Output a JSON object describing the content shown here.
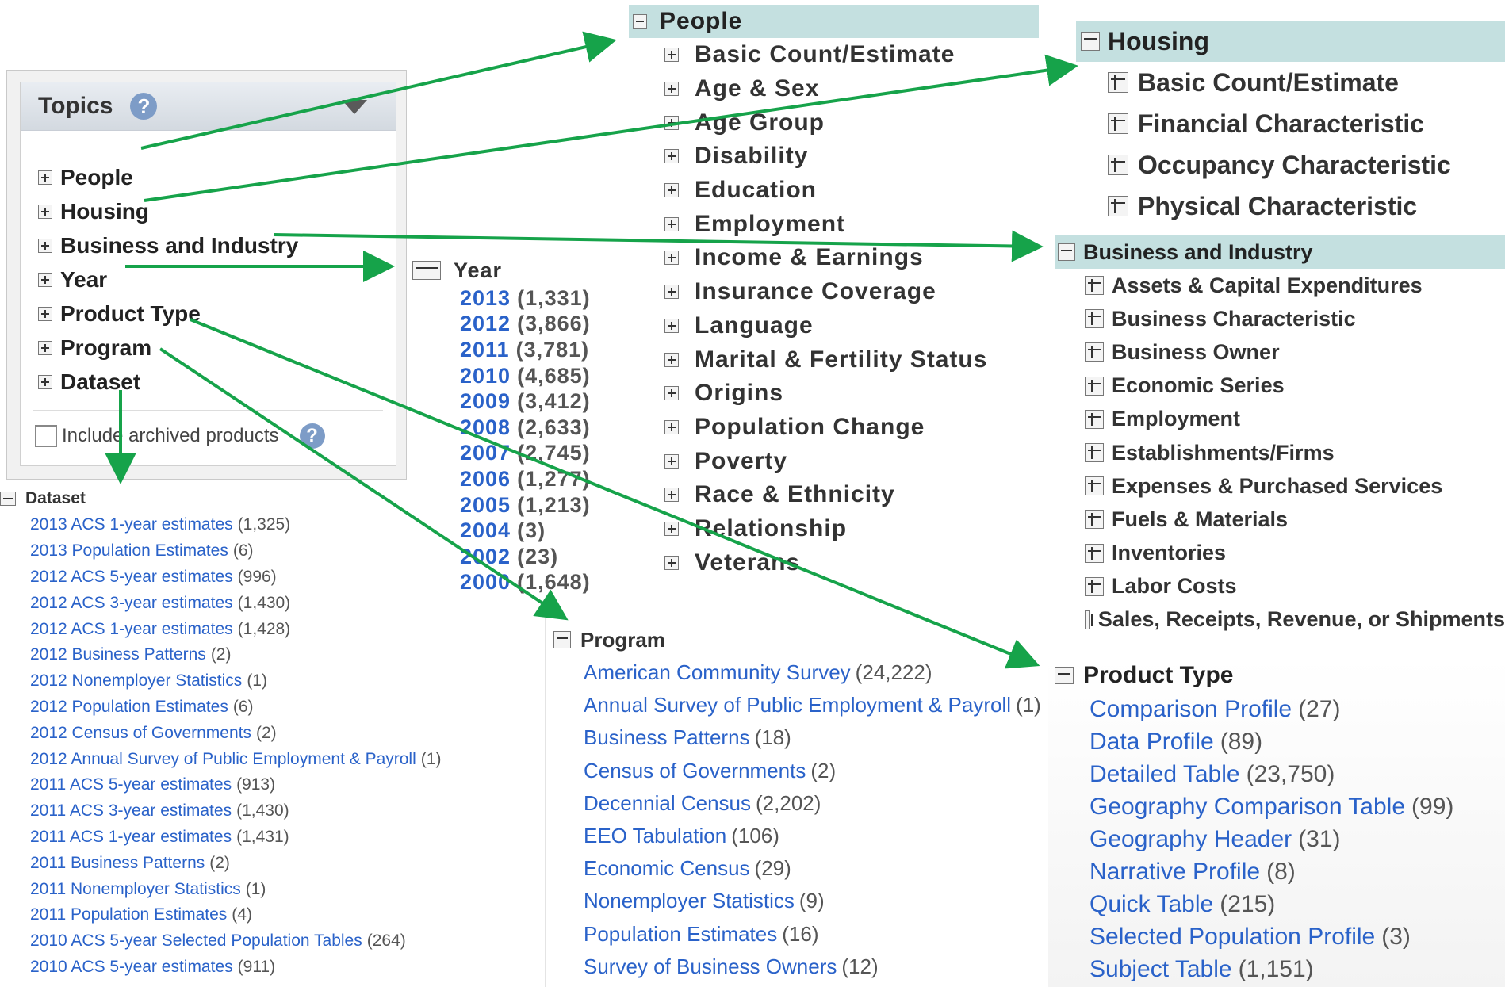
{
  "topics": {
    "title": "Topics",
    "help_icon": "question-icon",
    "collapse_icon": "triangle-down-icon",
    "items": [
      "People",
      "Housing",
      "Business and Industry",
      "Year",
      "Product Type",
      "Program",
      "Dataset"
    ],
    "archived_label": "Include archived products"
  },
  "people": {
    "title": "People",
    "items": [
      "Basic Count/Estimate",
      "Age & Sex",
      "Age Group",
      "Disability",
      "Education",
      "Employment",
      "Income & Earnings",
      "Insurance Coverage",
      "Language",
      "Marital & Fertility Status",
      "Origins",
      "Population Change",
      "Poverty",
      "Race & Ethnicity",
      "Relationship",
      "Veterans"
    ]
  },
  "housing": {
    "title": "Housing",
    "items": [
      "Basic Count/Estimate",
      "Financial Characteristic",
      "Occupancy Characteristic",
      "Physical Characteristic"
    ]
  },
  "business": {
    "title": "Business and Industry",
    "items": [
      "Assets & Capital Expenditures",
      "Business Characteristic",
      "Business Owner",
      "Economic Series",
      "Employment",
      "Establishments/Firms",
      "Expenses & Purchased Services",
      "Fuels & Materials",
      "Inventories",
      "Labor Costs",
      "Sales, Receipts, Revenue, or Shipments"
    ]
  },
  "year": {
    "title": "Year",
    "items": [
      {
        "label": "2013",
        "count": "(1,331)"
      },
      {
        "label": "2012",
        "count": "(3,866)"
      },
      {
        "label": "2011",
        "count": "(3,781)"
      },
      {
        "label": "2010",
        "count": "(4,685)"
      },
      {
        "label": "2009",
        "count": "(3,412)"
      },
      {
        "label": "2008",
        "count": "(2,633)"
      },
      {
        "label": "2007",
        "count": "(2,745)"
      },
      {
        "label": "2006",
        "count": "(1,277)"
      },
      {
        "label": "2005",
        "count": "(1,213)"
      },
      {
        "label": "2004",
        "count": "(3)"
      },
      {
        "label": "2002",
        "count": "(23)"
      },
      {
        "label": "2000",
        "count": "(1,648)"
      }
    ]
  },
  "dataset": {
    "title": "Dataset",
    "items": [
      {
        "label": "2013 ACS 1-year estimates",
        "count": "(1,325)"
      },
      {
        "label": "2013 Population Estimates",
        "count": "(6)"
      },
      {
        "label": "2012 ACS 5-year estimates",
        "count": "(996)"
      },
      {
        "label": "2012 ACS 3-year estimates",
        "count": "(1,430)"
      },
      {
        "label": "2012 ACS 1-year estimates",
        "count": "(1,428)"
      },
      {
        "label": "2012 Business Patterns",
        "count": "(2)"
      },
      {
        "label": "2012 Nonemployer Statistics",
        "count": "(1)"
      },
      {
        "label": "2012 Population Estimates",
        "count": "(6)"
      },
      {
        "label": "2012 Census of Governments",
        "count": "(2)"
      },
      {
        "label": "2012 Annual Survey of Public Employment & Payroll",
        "count": "(1)"
      },
      {
        "label": "2011 ACS 5-year estimates",
        "count": "(913)"
      },
      {
        "label": "2011 ACS 3-year estimates",
        "count": "(1,430)"
      },
      {
        "label": "2011 ACS 1-year estimates",
        "count": "(1,431)"
      },
      {
        "label": "2011 Business Patterns",
        "count": "(2)"
      },
      {
        "label": "2011 Nonemployer Statistics",
        "count": "(1)"
      },
      {
        "label": "2011 Population Estimates",
        "count": "(4)"
      },
      {
        "label": "2010 ACS 5-year Selected Population Tables",
        "count": "(264)"
      },
      {
        "label": "2010 ACS 5-year estimates",
        "count": "(911)"
      }
    ]
  },
  "program": {
    "title": "Program",
    "items": [
      {
        "label": "American Community Survey",
        "count": "(24,222)"
      },
      {
        "label": "Annual Survey of Public Employment & Payroll",
        "count": "(1)"
      },
      {
        "label": "Business Patterns",
        "count": "(18)"
      },
      {
        "label": "Census of Governments",
        "count": "(2)"
      },
      {
        "label": "Decennial Census",
        "count": "(2,202)"
      },
      {
        "label": "EEO Tabulation",
        "count": "(106)"
      },
      {
        "label": "Economic Census",
        "count": "(29)"
      },
      {
        "label": "Nonemployer Statistics",
        "count": "(9)"
      },
      {
        "label": "Population Estimates",
        "count": "(16)"
      },
      {
        "label": "Survey of Business Owners",
        "count": "(12)"
      }
    ]
  },
  "product_type": {
    "title": "Product Type",
    "items": [
      {
        "label": "Comparison Profile",
        "count": "(27)"
      },
      {
        "label": "Data Profile",
        "count": "(89)"
      },
      {
        "label": "Detailed Table",
        "count": "(23,750)"
      },
      {
        "label": "Geography Comparison Table",
        "count": "(99)"
      },
      {
        "label": "Geography Header",
        "count": "(31)"
      },
      {
        "label": "Narrative Profile",
        "count": "(8)"
      },
      {
        "label": "Quick Table",
        "count": "(215)"
      },
      {
        "label": "Selected Population Profile",
        "count": "(3)"
      },
      {
        "label": "Subject Table",
        "count": "(1,151)"
      }
    ]
  },
  "colors": {
    "link": "#2a62c9",
    "header_bg": "#c4e0e0",
    "arrow": "#16a34a"
  }
}
